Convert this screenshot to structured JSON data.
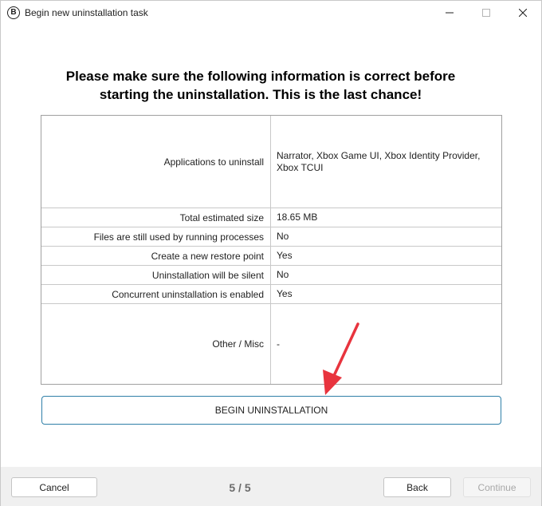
{
  "window": {
    "app_icon_letter": "B",
    "title": "Begin new uninstallation task"
  },
  "heading": {
    "line1": "Please make sure the following information is correct before",
    "line2": "starting the uninstallation. This is the last chance!"
  },
  "info": {
    "rows": [
      {
        "label": "Applications to uninstall",
        "value": "Narrator, Xbox Game UI, Xbox Identity Provider, Xbox TCUI"
      },
      {
        "label": "Total estimated size",
        "value": "18.65 MB"
      },
      {
        "label": "Files are still used by running processes",
        "value": "No"
      },
      {
        "label": "Create a new restore point",
        "value": "Yes"
      },
      {
        "label": "Uninstallation will be silent",
        "value": "No"
      },
      {
        "label": "Concurrent uninstallation is enabled",
        "value": "Yes"
      },
      {
        "label": "Other / Misc",
        "value": "-"
      }
    ]
  },
  "begin_button": "BEGIN UNINSTALLATION",
  "footer": {
    "cancel": "Cancel",
    "step": "5 / 5",
    "back": "Back",
    "continue": "Continue"
  },
  "colors": {
    "accent_border": "#2f7fa8",
    "annotation_arrow": "#e8343e"
  }
}
